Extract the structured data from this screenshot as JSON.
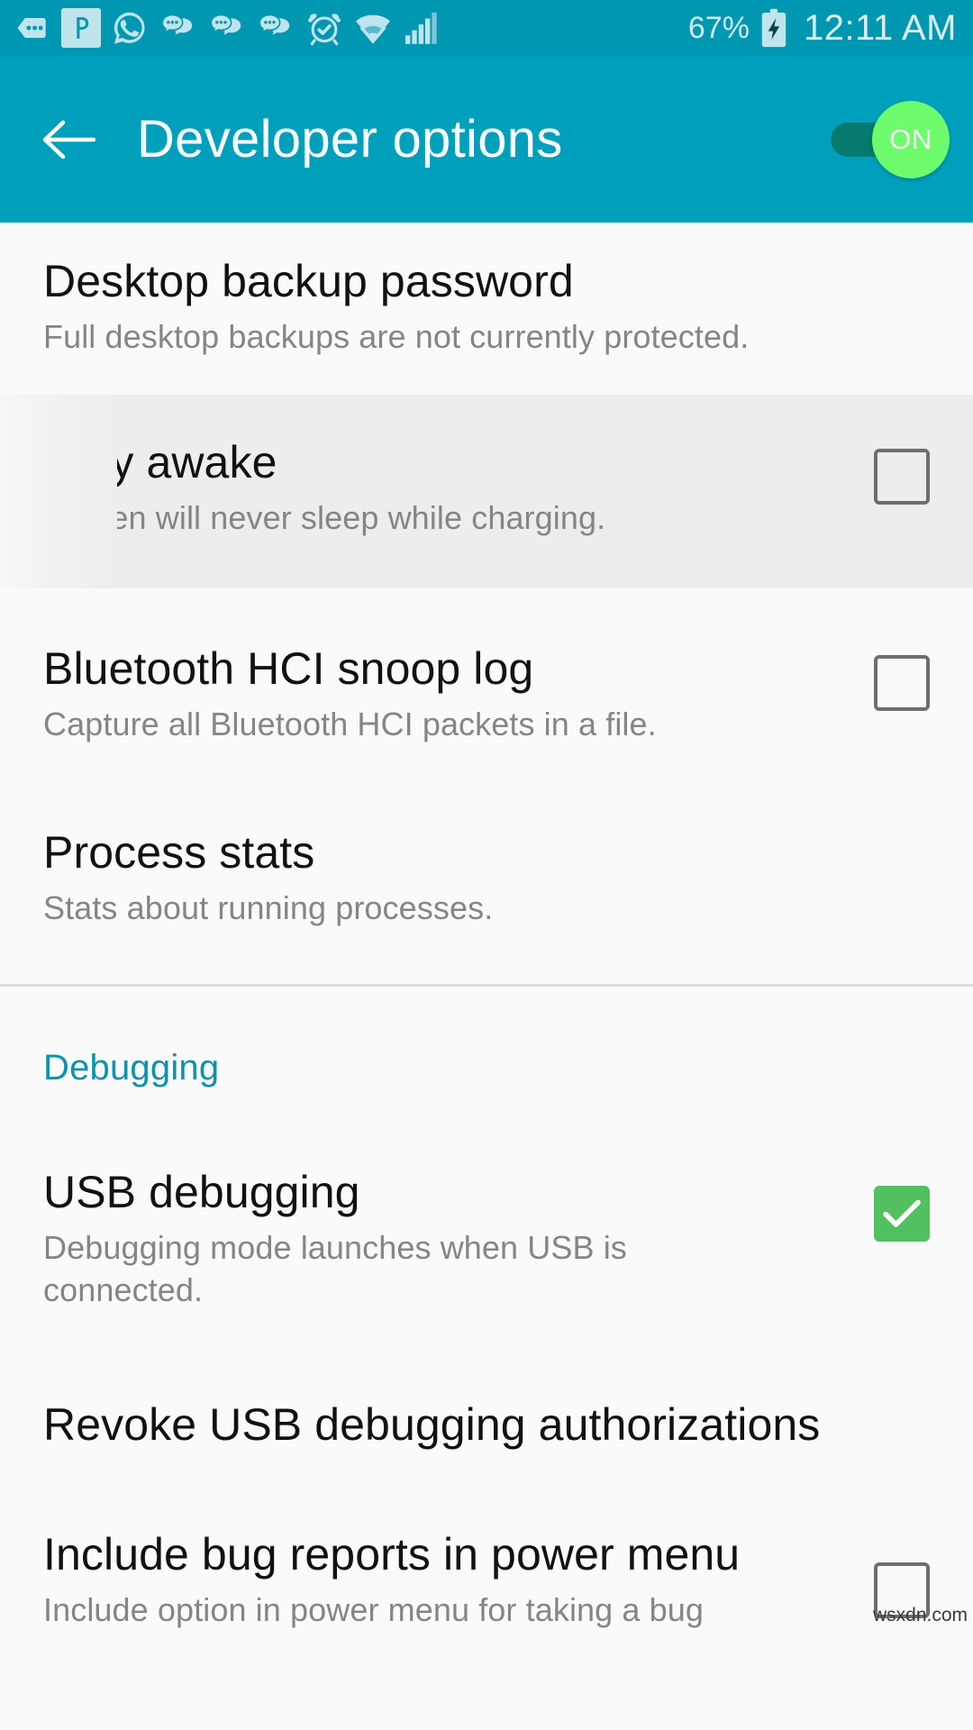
{
  "status_bar": {
    "icons": [
      {
        "name": "chat-hexagon-icon"
      },
      {
        "name": "pushbullet-icon"
      },
      {
        "name": "whatsapp-icon"
      },
      {
        "name": "message-bubbles-icon"
      },
      {
        "name": "message-bubbles-icon"
      },
      {
        "name": "message-bubbles-icon"
      },
      {
        "name": "alarm-clock-icon"
      },
      {
        "name": "wifi-icon"
      },
      {
        "name": "cellular-signal-icon"
      }
    ],
    "battery_percent": "67%",
    "battery_state": "charging",
    "time": "12:11 AM",
    "bg_color": "#0097b2",
    "fg_color": "#cfe9ef"
  },
  "app_bar": {
    "back_label": "back-arrow",
    "title": "Developer options",
    "master_switch": {
      "label": "ON",
      "checked": true,
      "track_color": "#067a6e",
      "thumb_color": "#6dfb6d"
    },
    "bg_color": "#00a0bd"
  },
  "settings": [
    {
      "name": "desktop-backup-password",
      "title": "Desktop backup password",
      "subtitle": "Full desktop backups are not currently protected.",
      "control": "none",
      "highlighted": false
    },
    {
      "name": "stay-awake",
      "title": "Stay awake",
      "subtitle": "Screen will never sleep while charging.",
      "control": "checkbox",
      "checked": false,
      "highlighted": true
    },
    {
      "name": "bluetooth-hci-snoop-log",
      "title": "Bluetooth HCI snoop log",
      "subtitle": "Capture all Bluetooth HCI packets in a file.",
      "control": "checkbox",
      "checked": false,
      "highlighted": false
    },
    {
      "name": "process-stats",
      "title": "Process stats",
      "subtitle": "Stats about running processes.",
      "control": "none",
      "highlighted": false
    }
  ],
  "debugging_section": {
    "header": "Debugging",
    "header_color": "#0b93ab",
    "items": [
      {
        "name": "usb-debugging",
        "title": "USB debugging",
        "subtitle": "Debugging mode launches when USB is connected.",
        "control": "checkbox",
        "checked": true,
        "highlighted": false
      },
      {
        "name": "revoke-usb-debugging-authorizations",
        "title": "Revoke USB debugging authorizations",
        "subtitle": "",
        "control": "none",
        "highlighted": false
      },
      {
        "name": "include-bug-reports-in-power-menu",
        "title": "Include bug reports in power menu",
        "subtitle": "Include option in power menu for taking a bug",
        "control": "checkbox",
        "checked": false,
        "highlighted": false
      }
    ]
  },
  "watermark": "wsxdn.com"
}
